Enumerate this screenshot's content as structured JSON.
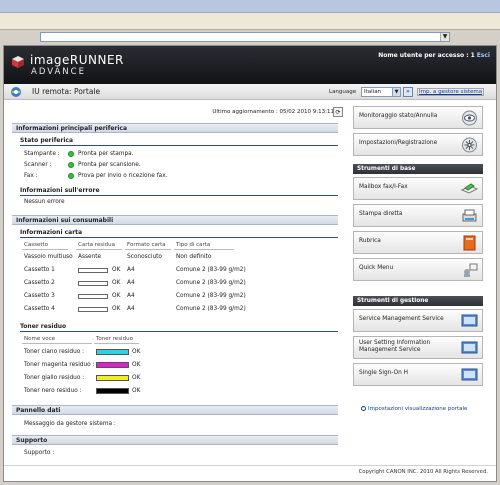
{
  "browser": {
    "address": ""
  },
  "header": {
    "brand_line1": "imageRUNNER",
    "brand_line2": "ADVANCE",
    "user_label": "Nome utente per accesso :",
    "user_value": "1",
    "exit": "Esci"
  },
  "subbar": {
    "title": "IU remota: Portale",
    "language_label": "Language",
    "language_value": "Italian",
    "manager_link": "Imp. a gestore sistema"
  },
  "main": {
    "last_update": "Ultimo aggiornamento : 05/02 2010 9:13:11",
    "sections": {
      "main_info": "Informazioni principali periferica",
      "device_status": "Stato periferica",
      "error_info": "Informazioni sull'errore",
      "consumables": "Informazioni sui consumabili",
      "paper_info": "Informazioni carta",
      "toner": "Toner residuo",
      "data_panel": "Pannello dati",
      "support": "Supporto"
    },
    "device_status": [
      {
        "label": "Stampante :",
        "value": "Pronta per stampa."
      },
      {
        "label": "Scanner :",
        "value": "Pronta per scansione."
      },
      {
        "label": "Fax :",
        "value": "Prova per invio o ricezione fax."
      }
    ],
    "error_text": "Nessun errore",
    "paper_headers": [
      "Cassetto",
      "Carta residua",
      "Formato carta",
      "Tipo di carta"
    ],
    "paper_rows": [
      {
        "name": "Vassoio multiuso",
        "remaining": "Assente",
        "size": "Sconosciuto",
        "type": "Non definito",
        "bar": false
      },
      {
        "name": "Cassetto 1",
        "remaining": "OK",
        "size": "A4",
        "type": "Comune 2 (83-99 g/m2)",
        "bar": true
      },
      {
        "name": "Cassetto 2",
        "remaining": "OK",
        "size": "A4",
        "type": "Comune 2 (83-99 g/m2)",
        "bar": true
      },
      {
        "name": "Cassetto 3",
        "remaining": "OK",
        "size": "A4",
        "type": "Comune 2 (83-99 g/m2)",
        "bar": true
      },
      {
        "name": "Cassetto 4",
        "remaining": "OK",
        "size": "A4",
        "type": "Comune 2 (83-99 g/m2)",
        "bar": true
      }
    ],
    "toner_headers": [
      "Nome voce",
      "Toner residuo"
    ],
    "toner_rows": [
      {
        "name": "Toner ciano residuo :",
        "status": "OK",
        "color": "#2ad4e0"
      },
      {
        "name": "Toner magenta residuo :",
        "status": "OK",
        "color": "#e020d0"
      },
      {
        "name": "Toner giallo residuo :",
        "status": "OK",
        "color": "#f2ee1a"
      },
      {
        "name": "Toner nero residuo :",
        "status": "OK",
        "color": "#000000"
      }
    ],
    "data_panel_text": "Messaggio da gestore sistema :",
    "support_text": "Supporto :"
  },
  "sidebar": {
    "top_buttons": [
      {
        "label": "Monitoraggio stato/Annulla",
        "icon": "eye-icon"
      },
      {
        "label": "Impostazioni/Registrazione",
        "icon": "settings-wheel-icon"
      }
    ],
    "basic_tools_header": "Strumenti di base",
    "basic_tools": [
      {
        "label": "Mailbox fax/I-Fax",
        "icon": "mailbox-icon"
      },
      {
        "label": "Stampa diretta",
        "icon": "printer-icon"
      },
      {
        "label": "Rubrica",
        "icon": "address-book-icon"
      },
      {
        "label": "Quick Menu",
        "icon": "quick-menu-icon"
      }
    ],
    "mgmt_tools_header": "Strumenti di gestione",
    "mgmt_tools": [
      {
        "label": "Service Management Service",
        "icon": "monitor-icon"
      },
      {
        "label": "User Setting Information Management Service",
        "icon": "monitor-icon"
      },
      {
        "label": "Single Sign-On H",
        "icon": "monitor-icon"
      }
    ],
    "portal_link": "Impostazioni visualizzazione portale"
  },
  "footer": {
    "copyright": "Copyright CANON INC. 2010 All Rights Reserved."
  }
}
